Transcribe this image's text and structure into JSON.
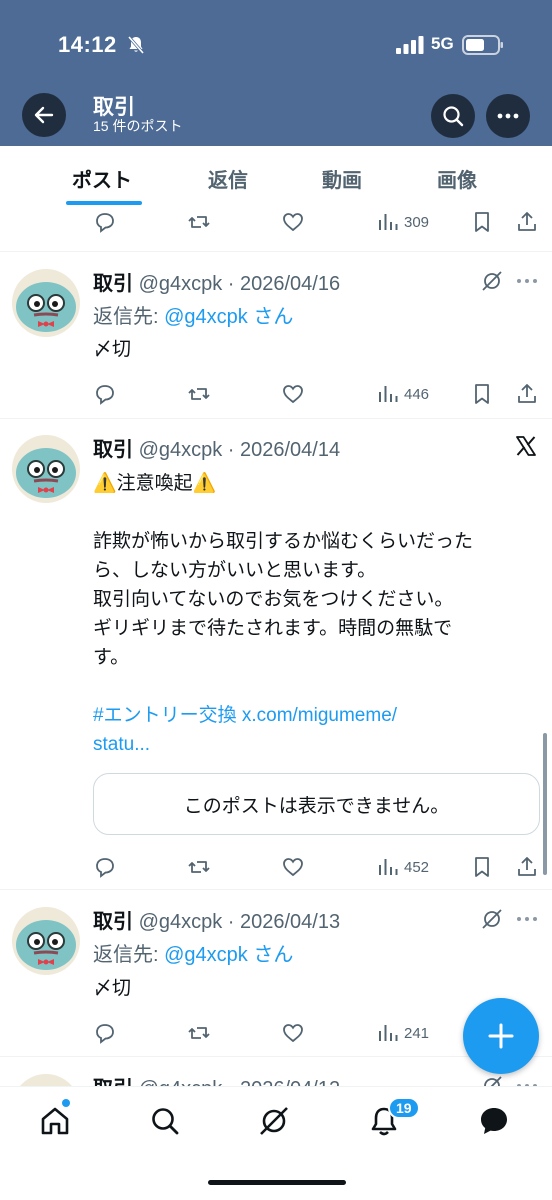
{
  "status_bar": {
    "time": "14:12",
    "network": "5G"
  },
  "header": {
    "title": "取引",
    "subtitle": "15 件のポスト"
  },
  "tabs": [
    {
      "label": "ポスト",
      "active": true
    },
    {
      "label": "返信",
      "active": false
    },
    {
      "label": "動画",
      "active": false
    },
    {
      "label": "画像",
      "active": false
    }
  ],
  "top_partial_post": {
    "views": "309"
  },
  "posts": [
    {
      "name": "取引",
      "handle_date": "@g4xcpk · 2026/04/16",
      "reply_prefix": "返信先: ",
      "reply_handle": "@g4xcpk さん",
      "text": "〆切",
      "views": "446"
    },
    {
      "name": "取引",
      "handle_date": "@g4xcpk · 2026/04/14",
      "warning_line": "⚠️注意喚起⚠️",
      "body_lines": [
        "詐欺が怖いから取引するか悩むくらいだった",
        "ら、しない方がいいと思います。",
        "取引向いてないのでお気をつけください。",
        "ギリギリまで待たされます。時間の無駄で",
        "す。"
      ],
      "hashtag_line": "#エントリー交換 x.com/migumeme/",
      "hashtag_line2": "statu...",
      "quote_unavailable": "このポストは表示できません。",
      "views": "452"
    },
    {
      "name": "取引",
      "handle_date": "@g4xcpk · 2026/04/13",
      "reply_prefix": "返信先: ",
      "reply_handle": "@g4xcpk さん",
      "text": "〆切",
      "views": "241"
    },
    {
      "name": "取引",
      "handle_date": "@g4xcpk · 2026/04/12"
    }
  ],
  "bottom_nav": {
    "notifications_badge": "19"
  },
  "colors": {
    "header_bg": "#4d6b94",
    "accent": "#1d9bf0",
    "text": "#0f1419",
    "muted": "#536471"
  },
  "icons": [
    "back-arrow-icon",
    "search-icon",
    "more-icon",
    "reply-icon",
    "repost-icon",
    "like-icon",
    "views-icon",
    "bookmark-icon",
    "share-icon",
    "grok-icon",
    "x-logo-icon",
    "compose-plus-icon",
    "home-icon",
    "explore-icon",
    "notifications-icon",
    "messages-icon"
  ]
}
